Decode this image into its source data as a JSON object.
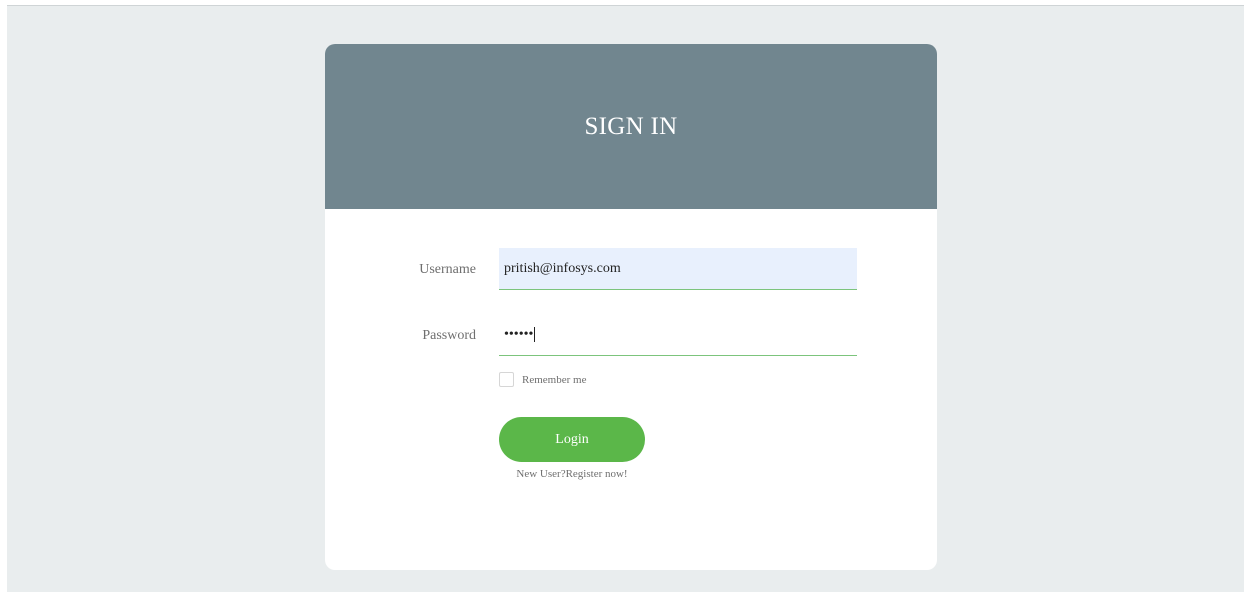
{
  "header": {
    "title": "SIGN IN"
  },
  "form": {
    "username_label": "Username",
    "username_value": "pritish@infosys.com",
    "password_label": "Password",
    "password_value": "••••••",
    "remember_label": "Remember me",
    "remember_checked": false,
    "login_label": "Login",
    "register_text": "New User?Register now!"
  },
  "colors": {
    "header_bg": "#71868f",
    "page_bg": "#e9edee",
    "login_button": "#5bb749",
    "input_underline": "#7cc47c",
    "autofill_bg": "#e8f0fd"
  }
}
